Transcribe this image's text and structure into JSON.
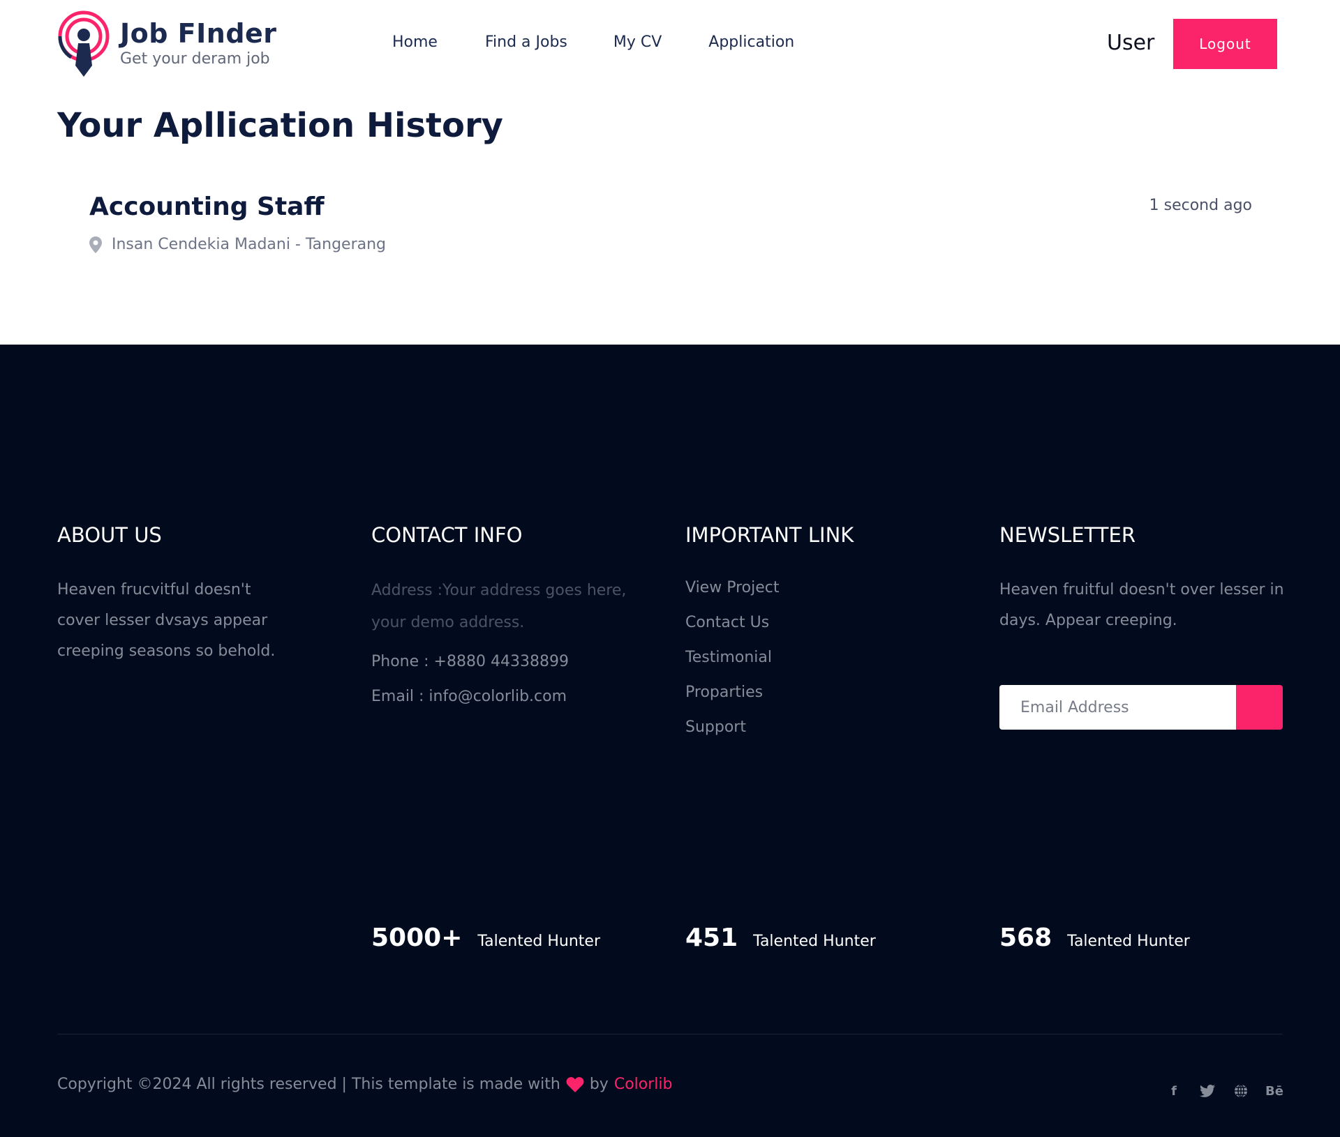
{
  "brand": {
    "title": "Job FInder",
    "tagline": "Get your deram job",
    "accent": "#fb246a",
    "navy": "#1b2a4e"
  },
  "nav": {
    "items": [
      {
        "label": "Home"
      },
      {
        "label": "Find a Jobs"
      },
      {
        "label": "My CV"
      },
      {
        "label": "Application"
      }
    ]
  },
  "user": {
    "label": "User",
    "logout_label": "Logout"
  },
  "main": {
    "title": "Your Apllication History",
    "applications": [
      {
        "job_title": "Accounting Staff",
        "location": "Insan Cendekia Madani - Tangerang",
        "time": "1 second ago",
        "location_icon": "map-pin-icon"
      }
    ]
  },
  "footer": {
    "background": "#010b1d",
    "about": {
      "heading": "ABOUT US",
      "text": "Heaven frucvitful doesn't cover lesser dvsays appear creeping seasons so behold."
    },
    "contact": {
      "heading": "CONTACT INFO",
      "address": "Address :Your address goes here, your demo address.",
      "phone": "Phone : +8880 44338899",
      "email": "Email : info@colorlib.com"
    },
    "links": {
      "heading": "IMPORTANT LINK",
      "items": [
        {
          "label": "View Project"
        },
        {
          "label": "Contact Us"
        },
        {
          "label": "Testimonial"
        },
        {
          "label": "Proparties"
        },
        {
          "label": "Support"
        }
      ]
    },
    "newsletter": {
      "heading": "NEWSLETTER",
      "text": "Heaven fruitful doesn't over lesser in days. Appear creeping.",
      "placeholder": "Email Address"
    },
    "stats": [
      {
        "number": "5000+",
        "label": "Talented Hunter"
      },
      {
        "number": "451",
        "label": "Talented Hunter"
      },
      {
        "number": "568",
        "label": "Talented Hunter"
      }
    ],
    "copyright": {
      "prefix": "Copyright ©2024 All rights reserved | This template is made with",
      "by": "by",
      "link": "Colorlib"
    },
    "socials": [
      {
        "icon": "facebook-icon",
        "glyph": "f"
      },
      {
        "icon": "twitter-icon",
        "glyph": ""
      },
      {
        "icon": "globe-icon",
        "glyph": ""
      },
      {
        "icon": "behance-icon",
        "glyph": "Bē"
      }
    ]
  }
}
